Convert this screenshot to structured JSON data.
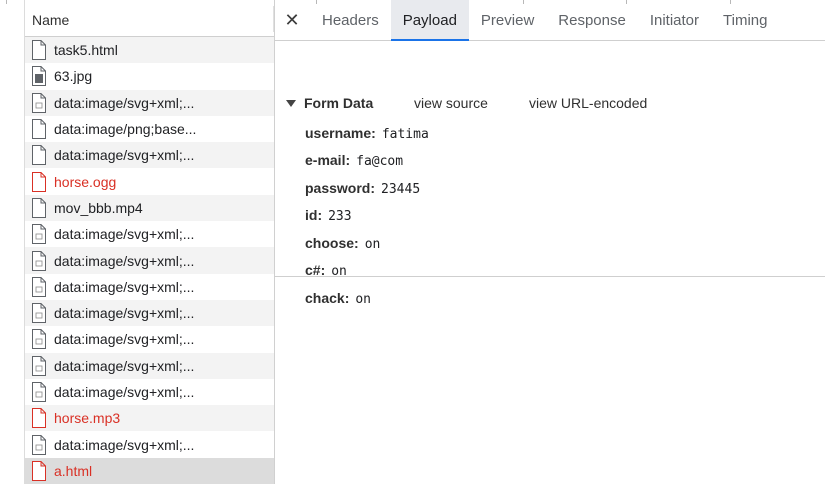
{
  "left_panel": {
    "column_header": "Name",
    "requests": [
      {
        "name": "task5.html",
        "icon": "file-icon",
        "status": "ok"
      },
      {
        "name": "63.jpg",
        "icon": "image-file-icon",
        "status": "ok"
      },
      {
        "name": "data:image/svg+xml;...",
        "icon": "svg-file-icon",
        "status": "ok"
      },
      {
        "name": "data:image/png;base...",
        "icon": "file-icon",
        "status": "ok"
      },
      {
        "name": "data:image/svg+xml;...",
        "icon": "file-icon",
        "status": "ok"
      },
      {
        "name": "horse.ogg",
        "icon": "file-icon",
        "status": "error"
      },
      {
        "name": "mov_bbb.mp4",
        "icon": "file-icon",
        "status": "ok"
      },
      {
        "name": "data:image/svg+xml;...",
        "icon": "svg-file-icon",
        "status": "ok"
      },
      {
        "name": "data:image/svg+xml;...",
        "icon": "svg-file-icon",
        "status": "ok"
      },
      {
        "name": "data:image/svg+xml;...",
        "icon": "svg-file-icon",
        "status": "ok"
      },
      {
        "name": "data:image/svg+xml;...",
        "icon": "svg-file-icon",
        "status": "ok"
      },
      {
        "name": "data:image/svg+xml;...",
        "icon": "svg-file-icon",
        "status": "ok"
      },
      {
        "name": "data:image/svg+xml;...",
        "icon": "svg-file-icon",
        "status": "ok"
      },
      {
        "name": "data:image/svg+xml;...",
        "icon": "svg-file-icon",
        "status": "ok"
      },
      {
        "name": "horse.mp3",
        "icon": "file-icon",
        "status": "error"
      },
      {
        "name": "data:image/svg+xml;...",
        "icon": "svg-file-icon",
        "status": "ok"
      },
      {
        "name": "a.html",
        "icon": "file-icon",
        "status": "error"
      }
    ],
    "selected_index": 16
  },
  "detail_panel": {
    "close_symbol": "✕",
    "tabs": [
      "Headers",
      "Payload",
      "Preview",
      "Response",
      "Initiator",
      "Timing"
    ],
    "active_tab": "Payload",
    "section": {
      "title": "Form Data",
      "view_source_label": "view source",
      "view_url_encoded_label": "view URL-encoded",
      "fields": [
        {
          "key": "username:",
          "value": "fatima"
        },
        {
          "key": "e-mail:",
          "value": "fa@com"
        },
        {
          "key": "password:",
          "value": "23445"
        },
        {
          "key": "id:",
          "value": "233"
        },
        {
          "key": "choose:",
          "value": "on"
        },
        {
          "key": "c#:",
          "value": "on"
        },
        {
          "key": "chack:",
          "value": "on"
        }
      ]
    }
  },
  "colors": {
    "accent": "#1a73e8",
    "error_text": "#d93025",
    "selected_row": "#dcdcdc",
    "alt_row": "#f3f3f3"
  }
}
